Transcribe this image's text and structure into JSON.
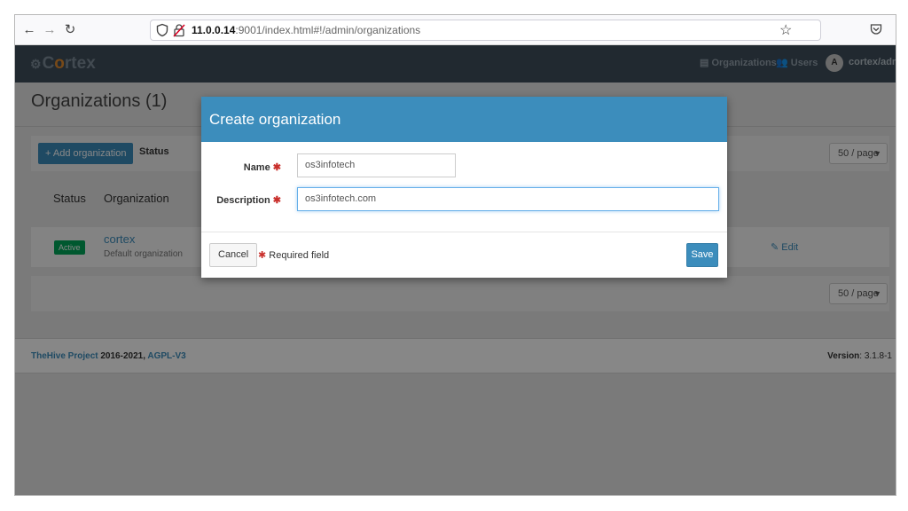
{
  "browser": {
    "url_host": "11.0.0.14",
    "url_rest": ":9001/index.html#!/admin/organizations"
  },
  "header": {
    "logo_prefix": "C",
    "logo_accent": "o",
    "logo_suffix": "rtex",
    "nav_organizations": "Organizations",
    "nav_users": "Users",
    "user_initial": "A",
    "user_name": "cortex/admin"
  },
  "page": {
    "title": "Organizations (1)",
    "add_button": "+ Add organization",
    "status_filter_label": "Status",
    "status_filter_partial": "S",
    "per_page_top": "50 / page",
    "per_page_bottom": "50 / page",
    "columns": [
      "Status",
      "Organization"
    ],
    "rows": [
      {
        "status": "Active",
        "name": "cortex",
        "description": "Default organization",
        "action": "Edit"
      }
    ]
  },
  "footer": {
    "project_link": "TheHive Project",
    "years": " 2016-2021, ",
    "license": "AGPL-V3",
    "version_label": "Version",
    "version_value": ": 3.1.8-1"
  },
  "modal": {
    "title": "Create organization",
    "name_label": "Name",
    "name_value": "os3infotech",
    "description_label": "Description",
    "description_value": "os3infotech.com",
    "required_marker": "✱",
    "cancel_label": "Cancel",
    "required_note": "Required field",
    "save_label": "Save"
  },
  "colors": {
    "primary": "#3c8dbc",
    "header_bg": "#3f4e5c",
    "active_badge": "#00a65a",
    "required": "#c9302c"
  }
}
